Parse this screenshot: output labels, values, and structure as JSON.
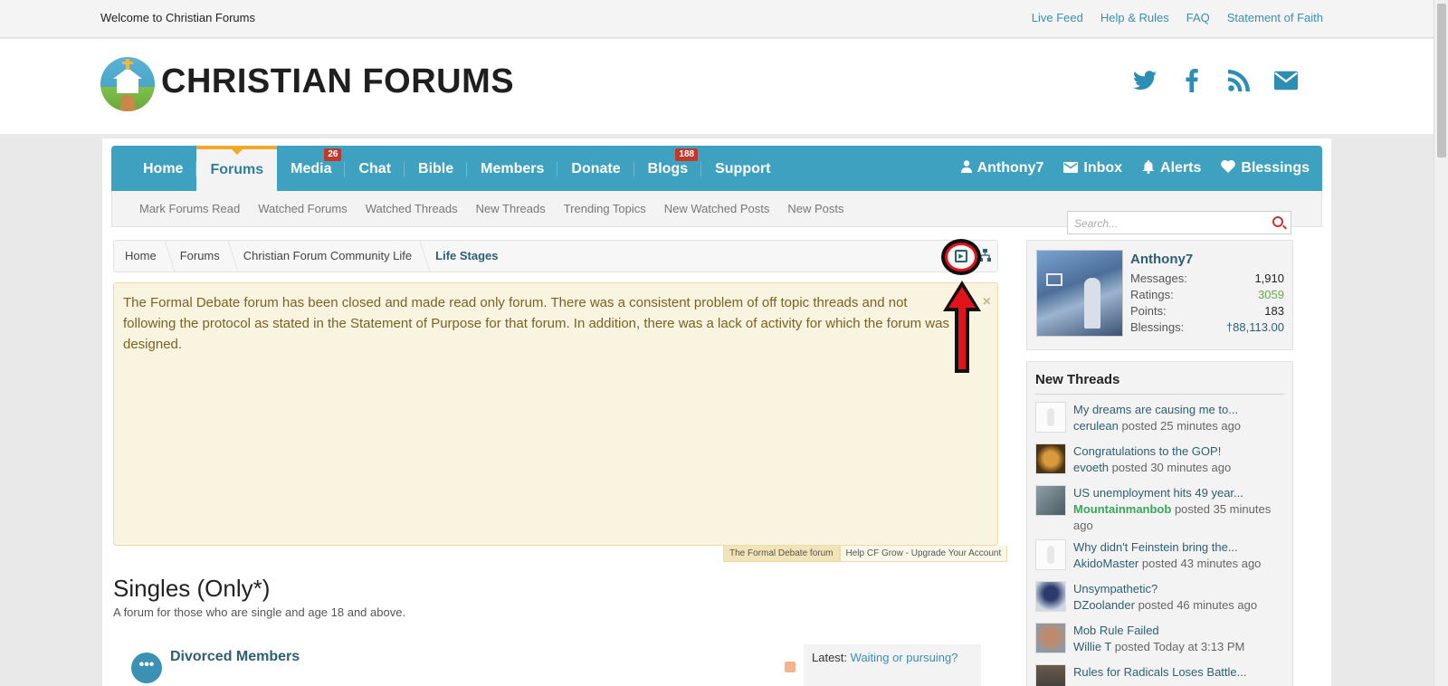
{
  "topbar": {
    "welcome": "Welcome to Christian Forums",
    "links": [
      "Live Feed",
      "Help & Rules",
      "FAQ",
      "Statement of Faith"
    ]
  },
  "header": {
    "logo_text": "CHRISTIAN FORUMS",
    "social_icons": [
      "twitter-icon",
      "facebook-icon",
      "rss-icon",
      "mail-icon"
    ]
  },
  "nav": {
    "tabs": [
      {
        "label": "Home"
      },
      {
        "label": "Forums",
        "active": true
      },
      {
        "label": "Media",
        "badge": "26"
      },
      {
        "label": "Chat"
      },
      {
        "label": "Bible"
      },
      {
        "label": "Members"
      },
      {
        "label": "Donate"
      },
      {
        "label": "Blogs",
        "badge": "188"
      },
      {
        "label": "Support"
      }
    ],
    "user_links": [
      "Anthony7",
      "Inbox",
      "Alerts",
      "Blessings"
    ]
  },
  "subnav": {
    "items": [
      "Mark Forums Read",
      "Watched Forums",
      "Watched Threads",
      "New Threads",
      "Trending Topics",
      "New Watched Posts",
      "New Posts"
    ]
  },
  "search": {
    "placeholder": "Search..."
  },
  "breadcrumb": [
    "Home",
    "Forums",
    "Christian Forum Community Life",
    "Life Stages"
  ],
  "notice": {
    "text": "The Formal Debate forum has been closed and made read only forum. There was a consistent problem of off topic threads and not following the protocol as stated in the Statement of Purpose for that forum. In addition, there was a lack of activity for which the forum was designed.",
    "close": "×",
    "tabs": [
      "The Formal Debate forum",
      "Help CF Grow - Upgrade Your Account"
    ]
  },
  "forum": {
    "title": "Singles (Only*)",
    "description": "A forum for those who are single and age 18 and above.",
    "first_node": {
      "title": "Divorced Members",
      "icon_text": "•••"
    },
    "latest_label": "Latest:",
    "latest_link": "Waiting or pursuing?"
  },
  "sidebar": {
    "user": {
      "name": "Anthony7",
      "stats": [
        {
          "label": "Messages:",
          "value": "1,910"
        },
        {
          "label": "Ratings:",
          "value": "3059"
        },
        {
          "label": "Points:",
          "value": "183"
        },
        {
          "label": "Blessings:",
          "value": "†88,113.00"
        }
      ]
    },
    "new_threads": {
      "heading": "New Threads",
      "items": [
        {
          "title": "My dreams are causing me to...",
          "author": "cerulean",
          "meta": "posted 25 minutes ago"
        },
        {
          "title": "Congratulations to the GOP!",
          "author": "evoeth",
          "meta": "posted 30 minutes ago"
        },
        {
          "title": "US unemployment hits 49 year...",
          "author": "Mountainmanbob",
          "meta": "posted 35 minutes ago"
        },
        {
          "title": "Why didn't Feinstein bring the...",
          "author": "AkidoMaster",
          "meta": "posted 43 minutes ago"
        },
        {
          "title": "Unsympathetic?",
          "author": "DZoolander",
          "meta": "posted 46 minutes ago"
        },
        {
          "title": "Mob Rule Failed",
          "author": "Willie T",
          "meta": "posted Today at 3:13 PM"
        },
        {
          "title": "Rules for Radicals Loses Battle...",
          "author": "",
          "meta": ""
        }
      ]
    }
  },
  "colors": {
    "nav": "#3fa1c0",
    "accent": "#f3a827",
    "link": "#2d5f73",
    "annotation": "#e0141a"
  }
}
